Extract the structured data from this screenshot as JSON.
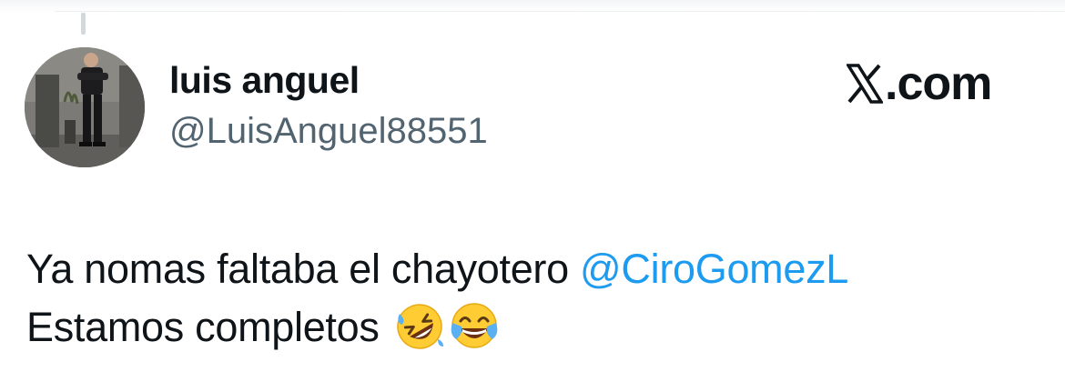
{
  "author": {
    "name": "luis anguel",
    "handle": "@LuisAnguel88551",
    "avatar_icon": "profile-photo"
  },
  "site": {
    "logo_icon": "x-logo-icon",
    "text": ".com"
  },
  "tweet": {
    "line1_text": "Ya nomas faltaba el chayotero ",
    "mention": "@CiroGomezL",
    "line2_text": "Estamos completos ",
    "emojis": [
      "rolling-on-floor-laughing-emoji",
      "face-with-tears-of-joy-emoji"
    ]
  },
  "colors": {
    "text": "#0f1419",
    "handle": "#536471",
    "mention": "#1d9bf0",
    "thread_line": "#cfd9de"
  }
}
